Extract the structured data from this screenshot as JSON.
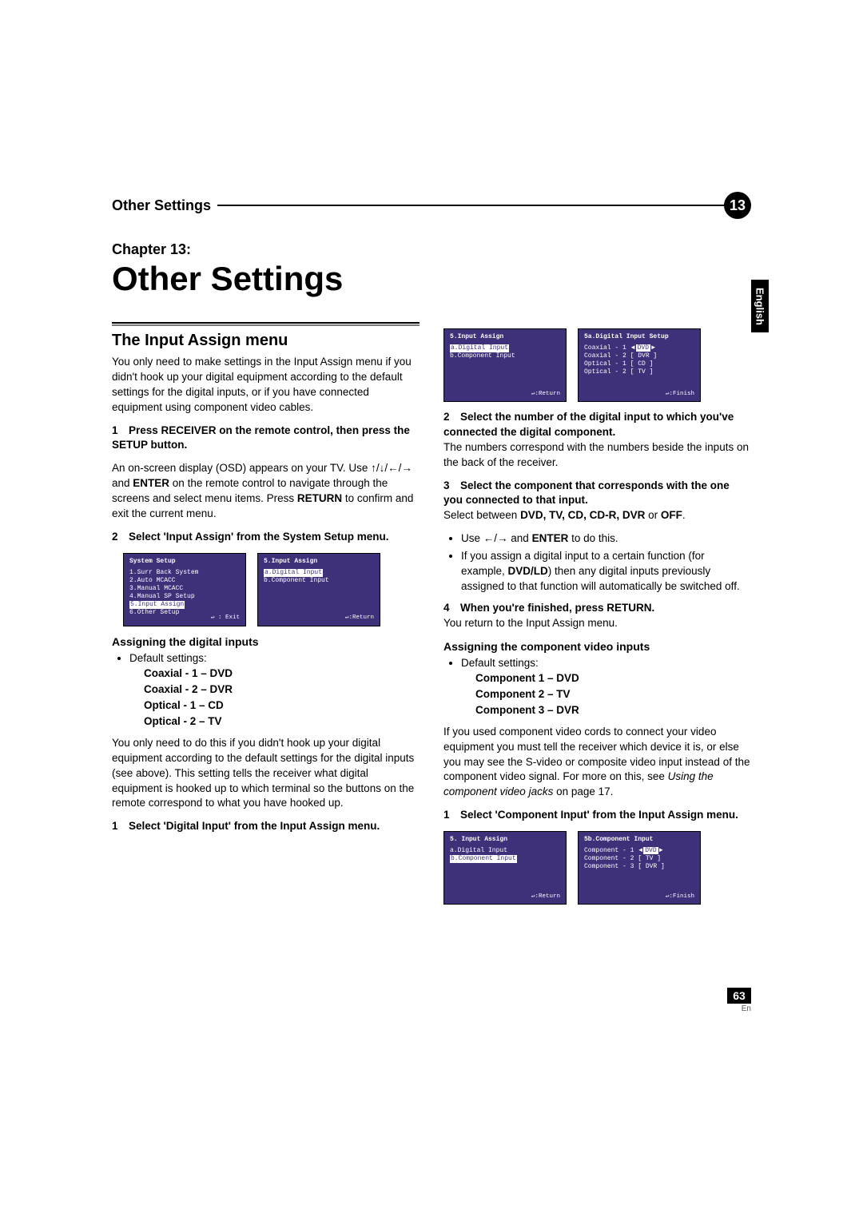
{
  "header": {
    "section": "Other Settings",
    "chapterNum": "13"
  },
  "chapter": {
    "label": "Chapter 13:",
    "title": "Other Settings"
  },
  "langTab": "English",
  "left": {
    "secTitle": "The Input Assign menu",
    "intro": "You only need to make settings in the Input Assign menu if you didn't hook up your digital equipment according to the default settings for the digital inputs, or if you have connected equipment using component video cables.",
    "step1": "1 Press RECEIVER on the remote control, then press the SETUP button.",
    "step1body_a": "An on-screen display (OSD) appears on your TV. Use ",
    "step1body_arrows": "↑/↓/←/→",
    "step1body_b": " and ",
    "step1body_enter": "ENTER",
    "step1body_c": " on the remote control to navigate through the screens and select menu items. Press ",
    "step1body_return": "RETURN",
    "step1body_d": " to confirm and exit the current menu.",
    "step2": "2 Select 'Input Assign' from the System Setup menu.",
    "osdA": {
      "title": "System Setup",
      "l1": "1.Surr Back System",
      "l2": "2.Auto MCACC",
      "l3": "3.Manual MCACC",
      "l4": "4.Manual SP Setup",
      "l5sel": "5.Input Assign",
      "l6": "6.Other Setup",
      "footer": "↵ : Exit"
    },
    "osdB": {
      "title": "5.Input Assign",
      "l1sel": "a.Digital Input",
      "l2": "b.Component Input",
      "footer": "↵:Return"
    },
    "subA": "Assigning the digital inputs",
    "defLabel": "Default settings:",
    "d1": "Coaxial - 1 – DVD",
    "d2": "Coaxial - 2 – DVR",
    "d3": "Optical - 1 – CD",
    "d4": "Optical - 2 – TV",
    "subApara": "You only need to do this if you didn't hook up your digital equipment according to the default settings for the digital inputs (see above). This setting tells the receiver what digital equipment is hooked up to which terminal so the buttons on the remote correspond to what you have hooked up.",
    "step3": "1 Select 'Digital Input' from the Input Assign menu."
  },
  "right": {
    "osdC": {
      "title": "5.Input Assign",
      "l1sel": "a.Digital Input",
      "l2": "b.Component Input",
      "footer": "↵:Return"
    },
    "osdD": {
      "title": "5a.Digital Input Setup",
      "r1a": "Coaxial - 1",
      "r1b": "DVD",
      "r2a": "Coaxial - 2",
      "r2b": "DVR",
      "r3a": "Optical - 1",
      "r3b": "CD",
      "r4a": "Optical - 2",
      "r4b": "TV",
      "footer": "↵:Finish"
    },
    "step2": "2 Select the number of the digital input to which you've connected the digital component.",
    "step2body": "The numbers correspond with the numbers beside the inputs on the back of the receiver.",
    "step3": "3 Select the component that corresponds with the one you connected to that input.",
    "step3body_a": "Select between ",
    "step3body_list": "DVD, TV, CD, CD-R, DVR",
    "step3body_b": " or ",
    "step3body_off": "OFF",
    "step3body_c": ".",
    "b1a": "Use ",
    "b1arrows": "←/→",
    "b1b": " and ",
    "b1enter": "ENTER",
    "b1c": " to do this.",
    "b2a": "If you assign a digital input to a certain function (for example, ",
    "b2dvd": "DVD/LD",
    "b2b": ") then any digital inputs previously assigned to that function will automatically be switched off.",
    "step4": "4 When you're finished, press RETURN.",
    "step4body": "You return to the Input Assign menu.",
    "subB": "Assigning the component video inputs",
    "defLabel": "Default settings:",
    "c1": "Component 1 – DVD",
    "c2": "Component 2 – TV",
    "c3": "Component 3 – DVR",
    "subBpara_a": "If you used component video cords to connect your video equipment you must tell the receiver which device it is, or else you may see the S-video or composite video input instead of the component video signal. For more on this, see ",
    "subBpara_ital": "Using the component video jacks",
    "subBpara_b": " on page 17.",
    "step1b": "1 Select 'Component Input' from the Input Assign menu.",
    "osdE": {
      "title": "5. Input Assign",
      "l1": "a.Digital Input",
      "l2sel": "b.Component Input",
      "footer": "↵:Return"
    },
    "osdF": {
      "title": "5b.Component Input",
      "r1a": "Component - 1",
      "r1b": "DVD",
      "r2a": "Component - 2",
      "r2b": "TV",
      "r3a": "Component - 3",
      "r3b": "DVR",
      "footer": "↵:Finish"
    }
  },
  "pageNum": "63",
  "pageLang": "En"
}
